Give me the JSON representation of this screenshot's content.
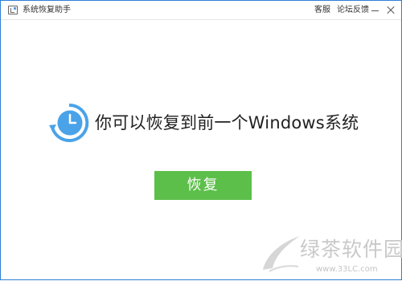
{
  "window": {
    "title": "系统恢复助手",
    "links": {
      "service": "客服",
      "feedback": "论坛反馈"
    },
    "controls": [
      "minimize-icon",
      "close-icon"
    ]
  },
  "main": {
    "icon": "clock-restore-icon",
    "message": "你可以恢复到前一个Windows系统",
    "button_label": "恢复"
  },
  "watermark": {
    "title": "绿茶软件园",
    "url": "www.33LC.com"
  },
  "colors": {
    "window_border": "#2d7fd6",
    "icon_blue": "#4aa3e8",
    "button_green": "#5cbf4a",
    "watermark_gray": "#c9c9c9"
  }
}
